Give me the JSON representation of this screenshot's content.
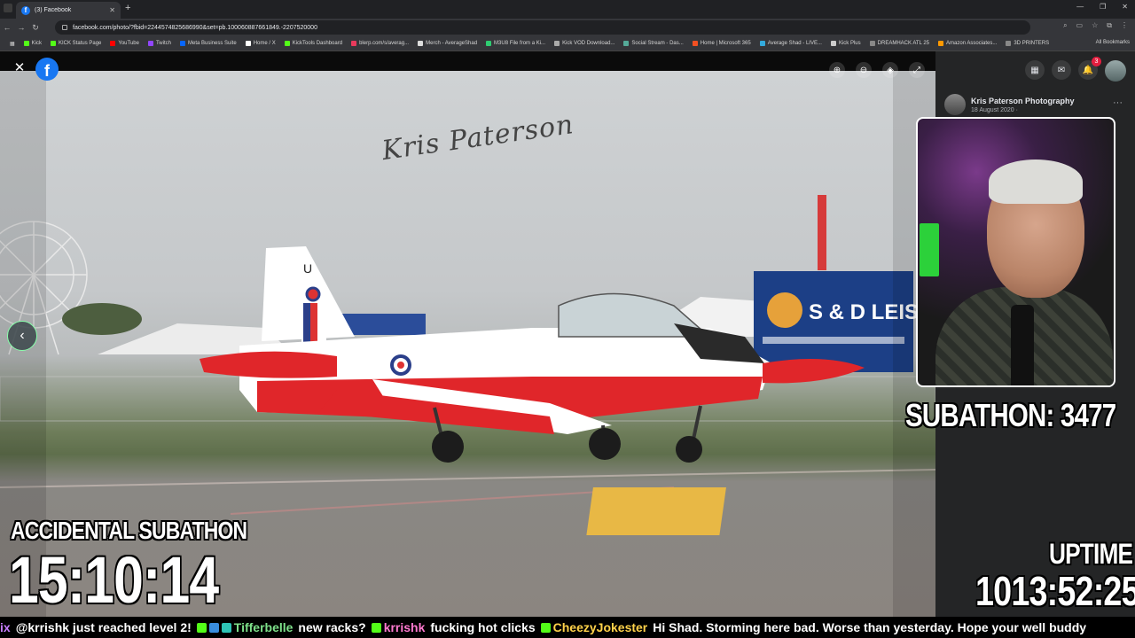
{
  "browser": {
    "tab_title": "(3) Facebook",
    "url": "facebook.com/photo/?fbid=2244574825686990&set=pb.100060887661849.-2207520000",
    "bookmarks": [
      "Kick",
      "KICK Status Page",
      "YouTube",
      "Twitch",
      "Meta Business Suite",
      "Home / X",
      "KickTools Dashboard",
      "blerp.com/s/averag...",
      "Merch - AverageShad",
      "M3U8 File from a Ki...",
      "Kick VOD Download...",
      "Social Stream - Das...",
      "Home | Microsoft 365",
      "Average Shad - LIVE...",
      "Kick Plus",
      "DREAMHACK ATL 25",
      "Amazon Associates...",
      "3D PRINTERS"
    ],
    "all_bookmarks": "All Bookmarks"
  },
  "facebook": {
    "logo": "f",
    "notification_count": "3",
    "post_author": "Kris Paterson Photography",
    "post_date": "18 August 2020 ·"
  },
  "photo": {
    "signature": "Kris Paterson",
    "banner_text": "S & D LEIS",
    "tail_letter": "U"
  },
  "overlay": {
    "subathon": "SUBATHON: 3477",
    "accidental_title": "ACCIDENTAL SUBATHON",
    "accidental_timer": "15:10:14",
    "uptime_label": "UPTIME",
    "uptime_timer": "1013:52:25"
  },
  "chat": [
    {
      "user": "ix",
      "message": "@krrishk just reached level 2!"
    },
    {
      "user": "Tifferbelle",
      "message": "new racks?"
    },
    {
      "user": "krrishk",
      "message": "fucking hot clicks"
    },
    {
      "user": "CheezyJokester",
      "message": "Hi Shad. Storming here bad. Worse than yesterday. Hope your well buddy"
    }
  ],
  "colors": {
    "facebook_blue": "#1877f2",
    "jet_red": "#e0262a",
    "notification_red": "#e41e3f"
  }
}
